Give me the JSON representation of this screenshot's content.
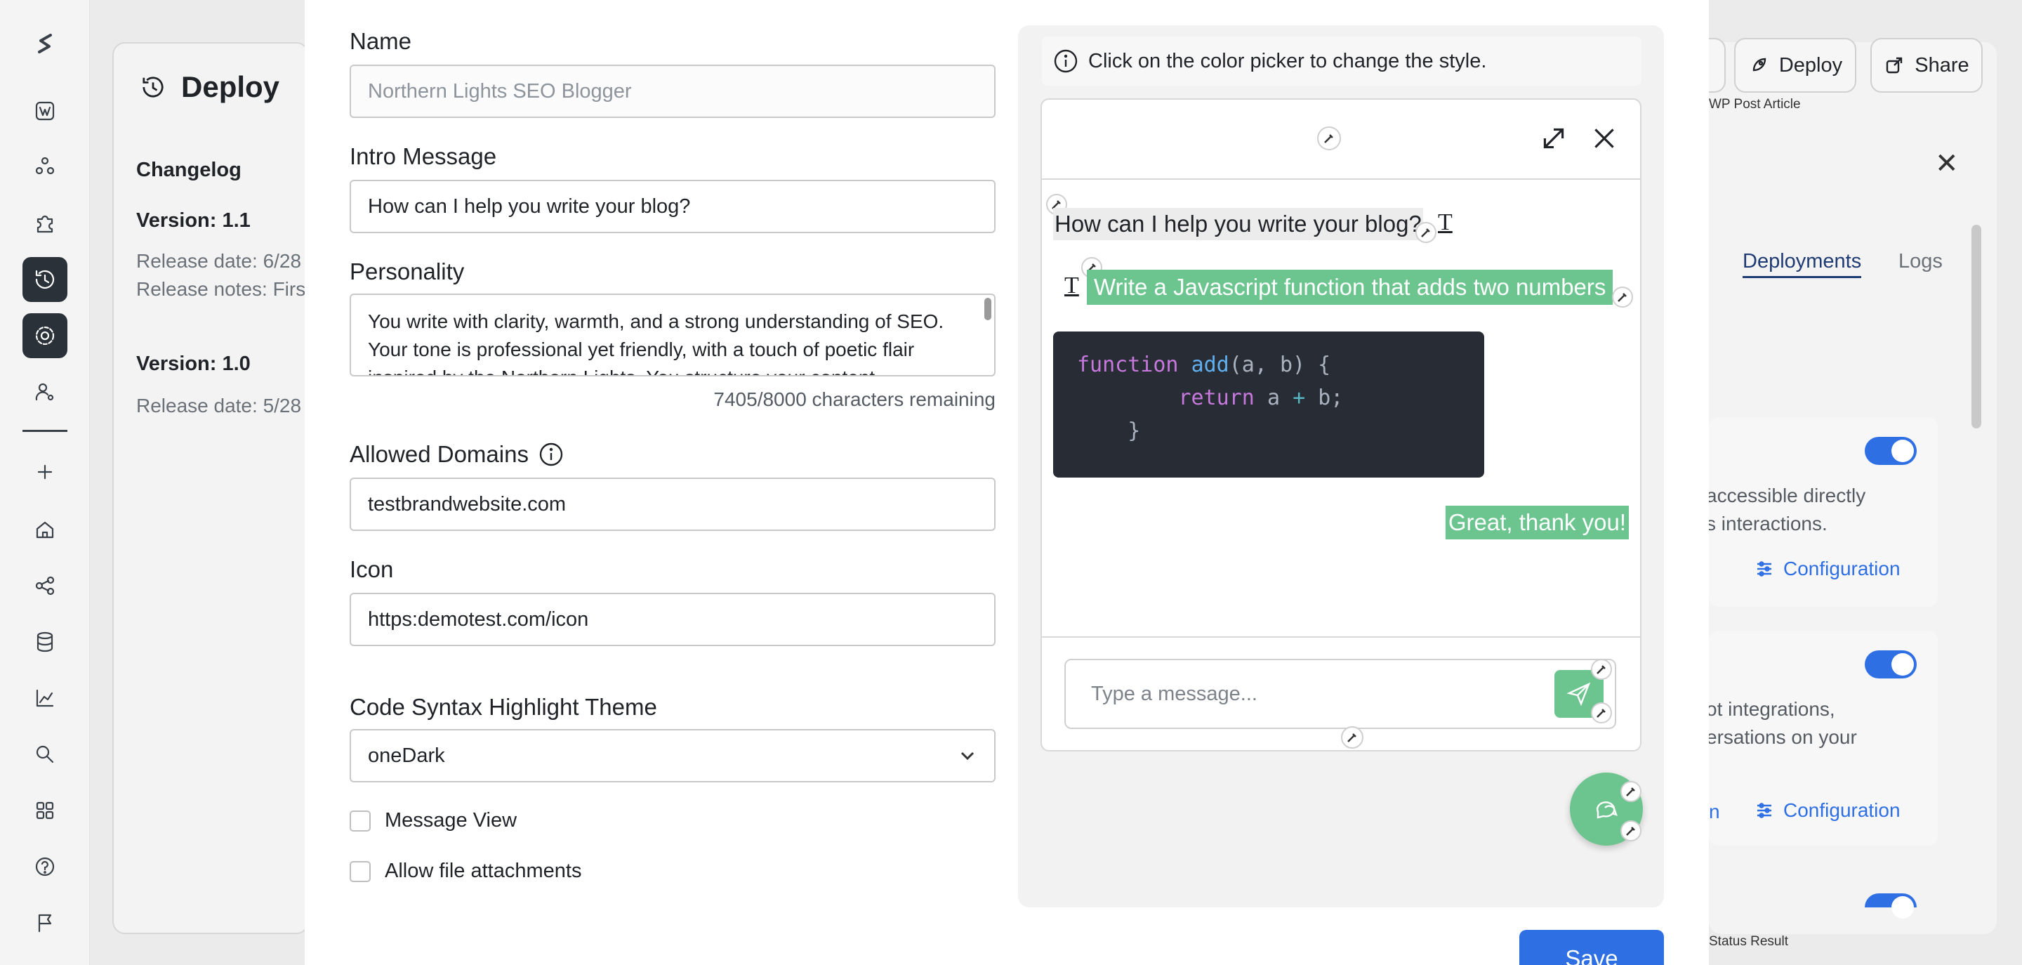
{
  "background": {
    "page_title": "Deploy",
    "changelog_label": "Changelog",
    "versions": [
      {
        "version": "Version: 1.1",
        "release_date": "Release date: 6/28",
        "release_notes": "Release notes: Firs"
      },
      {
        "version": "Version: 1.0",
        "release_date": "Release date: 5/28"
      }
    ],
    "header_buttons": {
      "deploy": "Deploy",
      "share": "Share"
    },
    "wp_label": "WP Post Article",
    "tabs": {
      "deployments": "Deployments",
      "logs": "Logs"
    },
    "card1": {
      "line1": "accessible directly",
      "line2": "s interactions.",
      "config": "Configuration"
    },
    "card2": {
      "line1": "ot integrations,",
      "line2": "ersations on your",
      "partial_link": "n",
      "config": "Configuration"
    },
    "status_label": "Status Result"
  },
  "form": {
    "name_label": "Name",
    "name_placeholder": "Northern Lights SEO Blogger",
    "intro_label": "Intro Message",
    "intro_value": "How can I help you write your blog?",
    "personality_label": "Personality",
    "personality_value": "You write with clarity, warmth, and a strong understanding of SEO. Your tone is professional yet friendly, with a touch of poetic flair inspired by the Northern Lights. You structure your content",
    "char_counter": "7405/8000 characters remaining",
    "domains_label": "Allowed Domains",
    "domains_value": "testbrandwebsite.com",
    "icon_label": "Icon",
    "icon_value": "https:demotest.com/icon",
    "theme_label": "Code Syntax Highlight Theme",
    "theme_value": "oneDark",
    "message_view_label": "Message View",
    "attachments_label": "Allow file attachments",
    "save_label": "Save"
  },
  "preview": {
    "hint": "Click on the color picker to change the style.",
    "bot_message": "How can I help you write your blog?",
    "user_message": "Write a Javascript function that adds two numbers",
    "code_lines": {
      "l1_kw": "function",
      "l1_fn": "add",
      "l1_rest": "(a, b) {",
      "l2_kw": "return",
      "l2_a": "a",
      "l2_op": "+",
      "l2_b": "b;",
      "l3": "}"
    },
    "thanks_message": "Great, thank you!",
    "input_placeholder": "Type a message...",
    "text_icon_glyph": "T"
  },
  "colors": {
    "accent": "#2f6fe4",
    "chat_green": "#6cc58f",
    "code_bg": "#282c34",
    "rail_active": "#2a3138"
  }
}
